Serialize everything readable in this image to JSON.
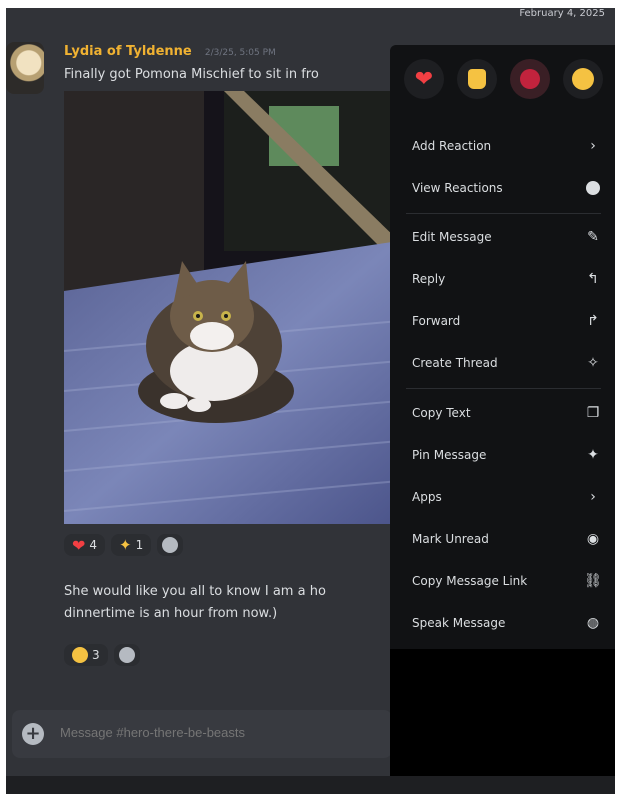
{
  "header": {
    "date": "February 4, 2025"
  },
  "message": {
    "author": "Lydia of Tyldenne",
    "timestamp": "2/3/25, 5:05 PM",
    "text": "Finally got Pomona Mischief to sit in fro",
    "reactions": [
      {
        "emoji": "heart",
        "count": "4"
      },
      {
        "emoji": "sparkles",
        "count": "1"
      }
    ]
  },
  "message2": {
    "line1": "She would like you all to know I am a ho",
    "line2": "dinnertime is an hour from now.)",
    "reactions": [
      {
        "emoji": "joy",
        "count": "3"
      }
    ]
  },
  "composer": {
    "placeholder": "Message #hero-there-be-beasts"
  },
  "context_menu": {
    "quick_emojis": [
      "heart",
      "thumbs-up",
      "rose",
      "grin"
    ],
    "groups": [
      [
        {
          "label": "Add Reaction",
          "icon": "chevron-right-icon"
        },
        {
          "label": "View Reactions",
          "icon": "smiley-icon"
        }
      ],
      [
        {
          "label": "Edit Message",
          "icon": "pencil-icon"
        },
        {
          "label": "Reply",
          "icon": "reply-icon"
        },
        {
          "label": "Forward",
          "icon": "forward-icon"
        },
        {
          "label": "Create Thread",
          "icon": "thread-icon"
        }
      ],
      [
        {
          "label": "Copy Text",
          "icon": "copy-icon"
        },
        {
          "label": "Pin Message",
          "icon": "pin-icon"
        },
        {
          "label": "Apps",
          "icon": "chevron-right-icon"
        },
        {
          "label": "Mark Unread",
          "icon": "mark-unread-icon"
        },
        {
          "label": "Copy Message Link",
          "icon": "link-icon"
        },
        {
          "label": "Speak Message",
          "icon": "speaker-icon"
        }
      ]
    ]
  },
  "colors": {
    "background": "#313338",
    "menu": "#111214",
    "author": "#f0b232",
    "text": "#dbdee1"
  }
}
